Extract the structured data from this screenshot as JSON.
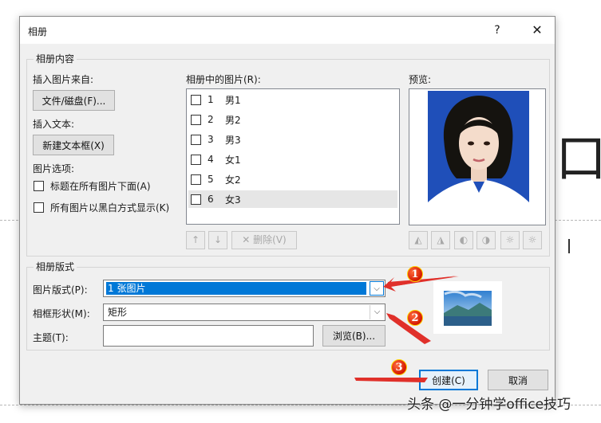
{
  "dialog": {
    "title": "相册",
    "help": "?",
    "close": "✕"
  },
  "content_group": {
    "legend": "相册内容",
    "insert_from_label": "插入图片来自:",
    "file_disk_button": "文件/磁盘(F)...",
    "insert_text_label": "插入文本:",
    "new_textbox_button": "新建文本框(X)",
    "picture_options_label": "图片选项:",
    "option_caption": "标题在所有图片下面(A)",
    "option_bw": "所有图片以黑白方式显示(K)",
    "pictures_label": "相册中的图片(R):",
    "pictures": [
      {
        "num": "1",
        "name": "男1",
        "checked": false,
        "selected": false
      },
      {
        "num": "2",
        "name": "男2",
        "checked": false,
        "selected": false
      },
      {
        "num": "3",
        "name": "男3",
        "checked": false,
        "selected": false
      },
      {
        "num": "4",
        "name": "女1",
        "checked": false,
        "selected": false
      },
      {
        "num": "5",
        "name": "女2",
        "checked": false,
        "selected": false
      },
      {
        "num": "6",
        "name": "女3",
        "checked": false,
        "selected": true
      }
    ],
    "move_up": "↑",
    "move_down": "↓",
    "delete_button": "✕ 删除(V)",
    "preview_label": "预览:"
  },
  "layout_group": {
    "legend": "相册版式",
    "picture_layout_label": "图片版式(P):",
    "picture_layout_value": "1 张图片",
    "frame_shape_label": "相框形状(M):",
    "frame_shape_value": "矩形",
    "theme_label": "主题(T):",
    "theme_value": "",
    "browse_button": "浏览(B)..."
  },
  "footer": {
    "create_button": "创建(C)",
    "cancel_button": "取消"
  },
  "annotations": [
    "1",
    "2",
    "3"
  ],
  "watermark": "头条 @一分钟学office技巧",
  "colors": {
    "accent": "#0078d7",
    "photo_bg": "#1f4fb9",
    "badge": "#e02a0a",
    "arrow": "#e0302a"
  }
}
